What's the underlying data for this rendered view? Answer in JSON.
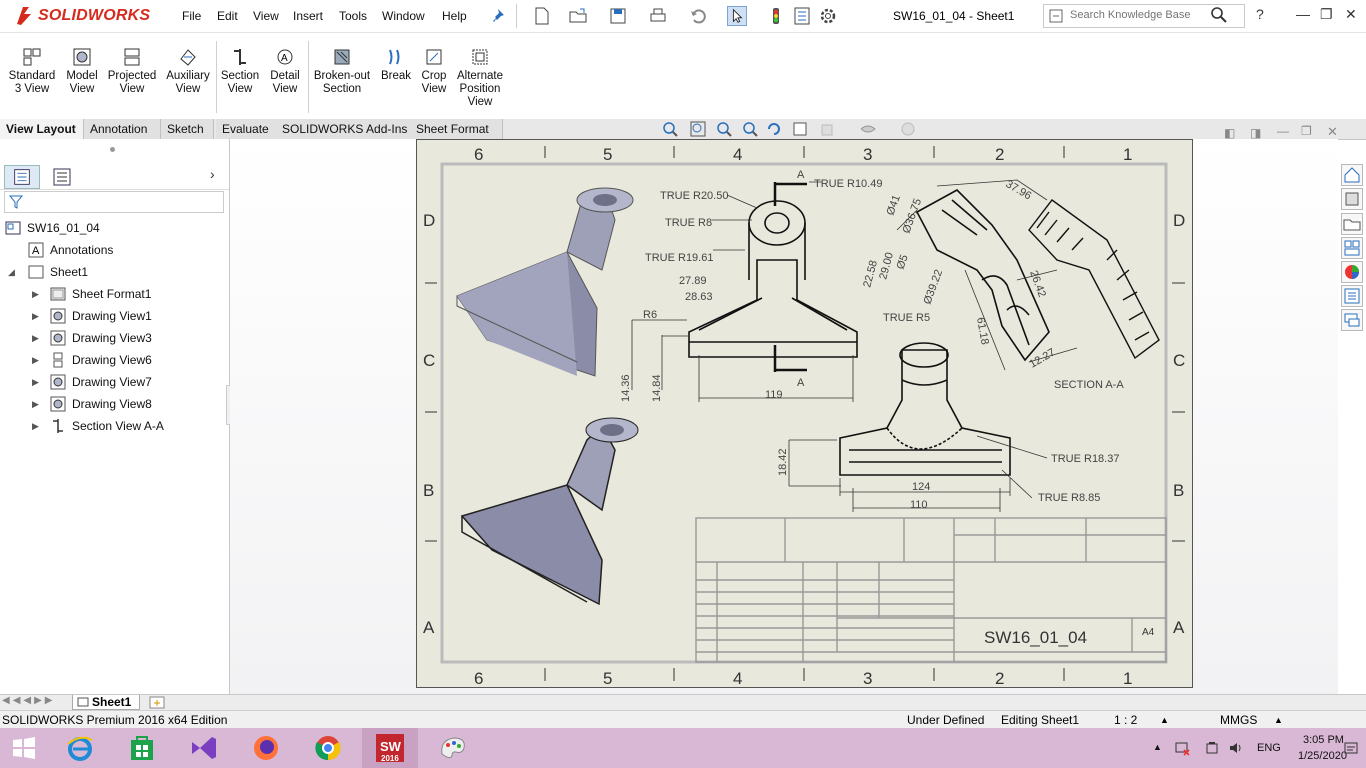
{
  "app": {
    "logo_text": "SOLIDWORKS",
    "document_title": "SW16_01_04 - Sheet1",
    "menu": [
      "File",
      "Edit",
      "View",
      "Insert",
      "Tools",
      "Window",
      "Help"
    ],
    "search_placeholder": "Search Knowledge Base"
  },
  "ribbon": {
    "buttons": [
      {
        "label1": "Standard",
        "label2": "3 View"
      },
      {
        "label1": "Model",
        "label2": "View"
      },
      {
        "label1": "Projected",
        "label2": "View"
      },
      {
        "label1": "Auxiliary",
        "label2": "View"
      },
      {
        "label1": "Section",
        "label2": "View"
      },
      {
        "label1": "Detail",
        "label2": "View"
      },
      {
        "label1": "Broken-out",
        "label2": "Section"
      },
      {
        "label1": "Break",
        "label2": ""
      },
      {
        "label1": "Crop",
        "label2": "View"
      },
      {
        "label1": "Alternate",
        "label2": "Position",
        "label3": "View"
      }
    ]
  },
  "tabs": [
    "View Layout",
    "Annotation",
    "Sketch",
    "Evaluate",
    "SOLIDWORKS Add-Ins",
    "Sheet Format"
  ],
  "tree": {
    "root": "SW16_01_04",
    "annotations": "Annotations",
    "sheet": "Sheet1",
    "children": [
      "Sheet Format1",
      "Drawing View1",
      "Drawing View3",
      "Drawing View6",
      "Drawing View7",
      "Drawing View8",
      "Section View A-A"
    ]
  },
  "drawing": {
    "zones_top": [
      "6",
      "5",
      "4",
      "3",
      "2",
      "1"
    ],
    "zones_side": [
      "D",
      "C",
      "B",
      "A"
    ],
    "dims": {
      "r2050": "TRUE R20.50",
      "r1049": "TRUE R10.49",
      "r8": "TRUE R8",
      "r1961": "TRUE R19.61",
      "d2789": "27.89",
      "d2863": "28.63",
      "r6": "R6",
      "d1436": "14.36",
      "d1484": "14.84",
      "d119": "119",
      "r5": "TRUE R5",
      "d2258": "22.58",
      "d2900": "29.00",
      "d3796": "37.96",
      "d41": "Ø41",
      "d3675": "Ø36.75",
      "d5": "Ø5",
      "d3922": "Ø39.22",
      "d2642": "26.42",
      "d6118": "61.18",
      "d1227": "12.27",
      "section": "SECTION A-A",
      "r1837": "TRUE R18.37",
      "r885": "TRUE R8.85",
      "d1842": "18.42",
      "d124": "124",
      "d110": "110",
      "cut": "A"
    },
    "title_block_number": "SW16_01_04",
    "title_block_size": "A4"
  },
  "sheet_tab": "Sheet1",
  "status": {
    "edition": "SOLIDWORKS Premium 2016 x64 Edition",
    "defined": "Under Defined",
    "editing": "Editing Sheet1",
    "scale": "1 : 2",
    "units": "MMGS"
  },
  "taskbar": {
    "time": "3:05 PM",
    "date": "1/25/2020",
    "lang": "ENG",
    "sw_label": "2016"
  },
  "colors": {
    "brand": "#d52b1e",
    "sheet": "#e9e8dc",
    "taskbar": "#d9b8d5",
    "part": "#8a8ca8"
  }
}
